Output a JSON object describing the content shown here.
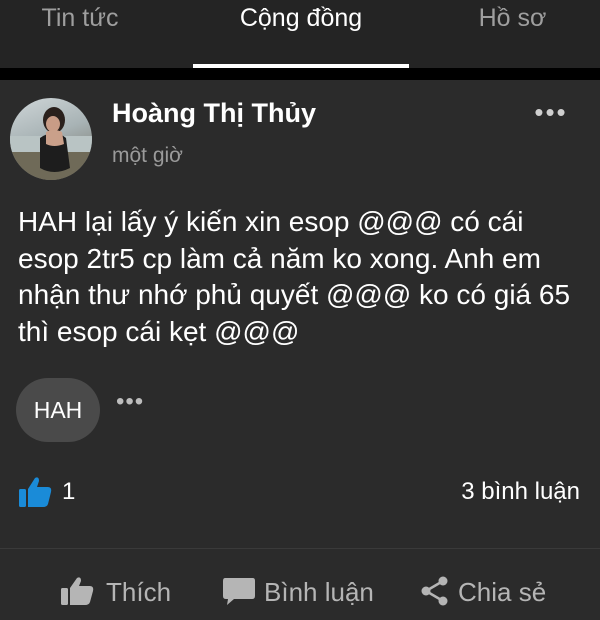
{
  "tabs": [
    {
      "label": "Tin tức",
      "active": false
    },
    {
      "label": "Cộng đồng",
      "active": true
    },
    {
      "label": "Hồ sơ",
      "active": false
    }
  ],
  "post": {
    "author": "Hoàng Thị Thủy",
    "time": "một giờ",
    "more_icon": "ellipsis-icon",
    "body": "HAH lại lấy ý kiến xin esop @@@ có cái esop 2tr5 cp làm cả năm ko xong. Anh em nhận thư nhớ phủ  quyết @@@ ko có giá 65 thì esop cái kẹt @@@",
    "tags": [
      "HAH"
    ],
    "likes": "1",
    "comments": "3 bình luận",
    "actions": {
      "like": "Thích",
      "comment": "Bình luận",
      "share": "Chia sẻ"
    }
  },
  "colors": {
    "background": "#000000",
    "nav_background": "#242424",
    "card_background": "#2b2b2b",
    "chip_background": "#4a4a4a",
    "like_blue": "#1a8bd8",
    "muted_text": "#9a9a9a"
  }
}
